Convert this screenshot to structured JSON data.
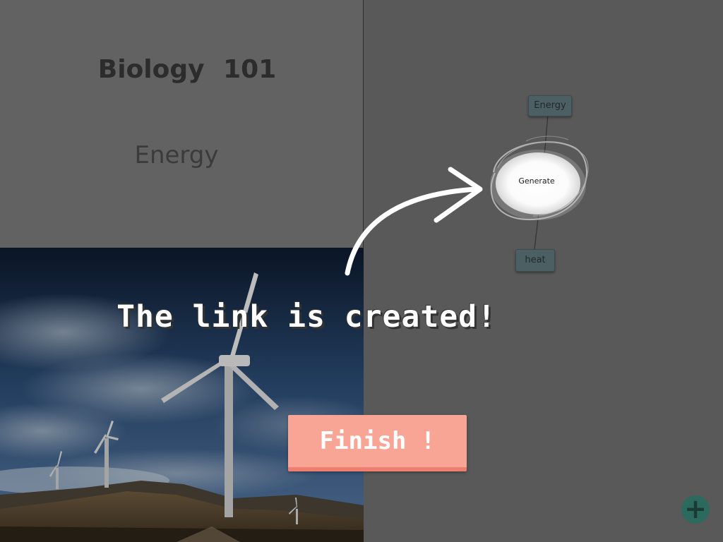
{
  "left_panel": {
    "course_title": "Biology  101",
    "topic_title": "Energy",
    "photo_icon": "wind-turbines-photo"
  },
  "concept_map": {
    "nodes": [
      "Energy",
      "Generate",
      "heat"
    ],
    "add_icon": "plus-icon"
  },
  "tutorial": {
    "message": "The link is created!",
    "finish_label": "Finish !",
    "arrow_icon": "curved-arrow-icon"
  },
  "colors": {
    "finish_button": "#f9a596",
    "add_button": "#2b6a5c",
    "node": "#4c5f63"
  }
}
